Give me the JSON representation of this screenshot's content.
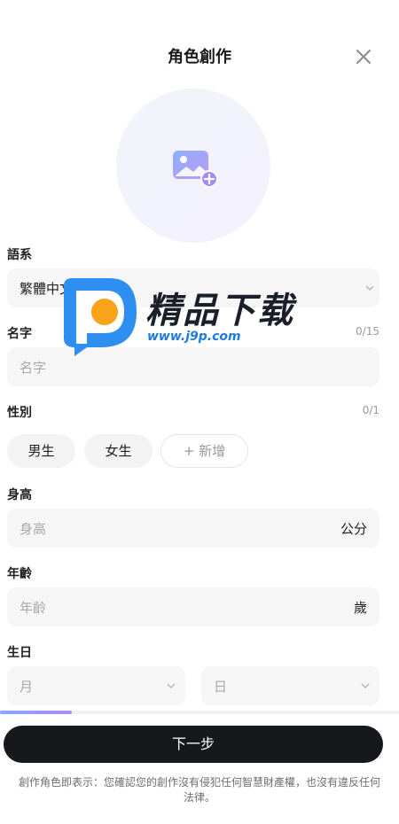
{
  "header": {
    "title": "角色創作",
    "close_icon": "close-icon"
  },
  "avatar": {
    "icon": "add-image-icon"
  },
  "language": {
    "label": "語系",
    "value": "繁體中文"
  },
  "name": {
    "label": "名字",
    "counter": "0/15",
    "placeholder": "名字"
  },
  "gender": {
    "label": "性別",
    "counter": "0/1",
    "options": [
      "男生",
      "女生"
    ],
    "add_label": "+ 新增"
  },
  "height": {
    "label": "身高",
    "placeholder": "身高",
    "unit": "公分"
  },
  "age": {
    "label": "年齡",
    "placeholder": "年齡",
    "unit": "歲"
  },
  "birthday": {
    "label": "生日",
    "month_placeholder": "月",
    "day_placeholder": "日"
  },
  "progress": {
    "fraction": 0.18
  },
  "next_button": {
    "label": "下一步"
  },
  "disclaimer": "創作角色即表示：您確認您的創作沒有侵犯任何智慧財產權，也沒有違反任何法律。",
  "watermark": {
    "text": "精品下载",
    "url": "www.j9p.com"
  },
  "colors": {
    "accent_start": "#86a5ff",
    "accent_end": "#b28cf2",
    "button": "#17181c",
    "field_bg": "#f6f6f6"
  }
}
